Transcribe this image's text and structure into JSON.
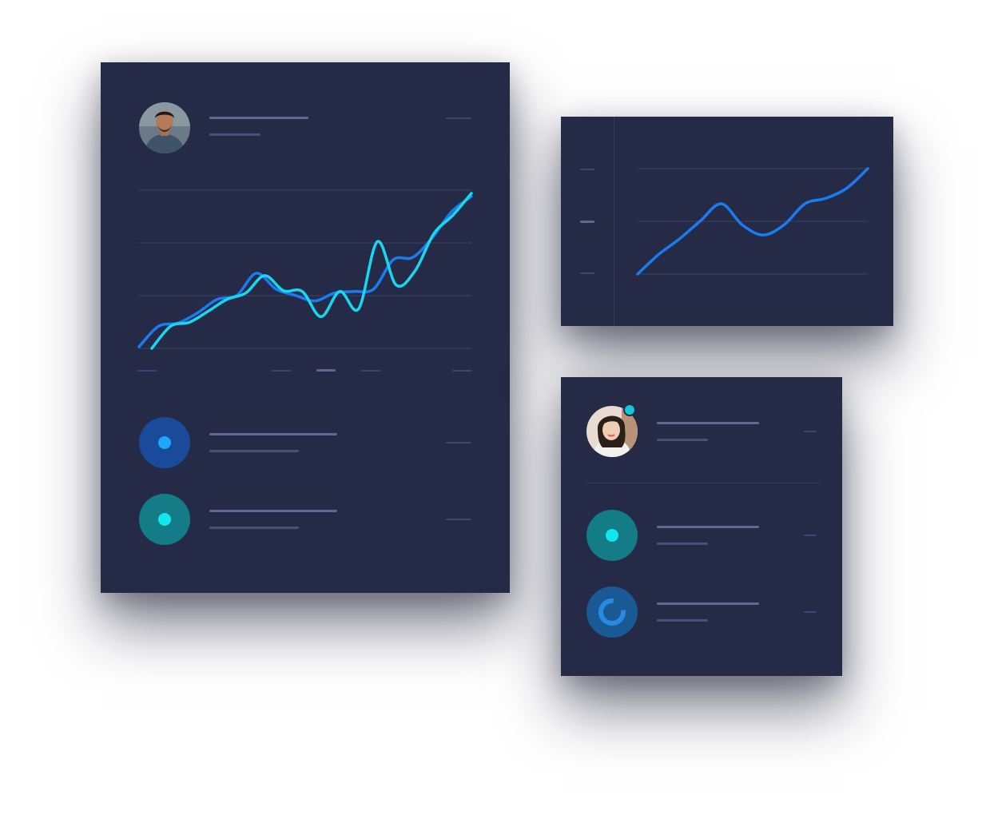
{
  "theme": {
    "card_bg": "#252b46",
    "grid_line": "#333b5c",
    "placeholder_title": "#5e6894",
    "placeholder_sub": "#46507a",
    "series_blue": "#1a7cf0",
    "series_cyan": "#18d8f0"
  },
  "main_card": {
    "profile": {
      "avatar_icon": "male-user-avatar-icon"
    },
    "list_items": [
      {
        "icon": "blue-dot-icon",
        "circle_color": "#1a4a9a",
        "dot_color": "#1aa8ff"
      },
      {
        "icon": "teal-dot-icon",
        "circle_color": "#137c86",
        "dot_color": "#12e6f0"
      }
    ]
  },
  "chart_card": {},
  "people_card": {
    "profile": {
      "avatar_icon": "female-user-avatar-icon",
      "status_color": "#12c8d8"
    },
    "list_items": [
      {
        "icon": "teal-dot-icon",
        "circle_color": "#137c86",
        "dot_color": "#12e6f0"
      },
      {
        "icon": "loading-ring-icon",
        "circle_color": "#1a5a94",
        "ring_color": "#2a8ae0"
      }
    ]
  },
  "chart_data": [
    {
      "type": "line",
      "series": [
        {
          "values": [
            2,
            28,
            32,
            45,
            62,
            67,
            95,
            75,
            67,
            60,
            70,
            72,
            75,
            112,
            115,
            140,
            173,
            192
          ]
        },
        {
          "values": [
            0,
            28,
            33,
            47,
            62,
            70,
            92,
            73,
            72,
            40,
            72,
            50,
            135,
            80,
            98,
            145,
            168,
            196
          ]
        }
      ],
      "ylim": [
        0,
        200
      ],
      "grid": true
    },
    {
      "type": "line",
      "series": [
        {
          "values": [
            0,
            25,
            45,
            68,
            90,
            63,
            50,
            63,
            90,
            97,
            110,
            135
          ]
        }
      ],
      "ylim": [
        0,
        135
      ],
      "grid": true
    }
  ]
}
